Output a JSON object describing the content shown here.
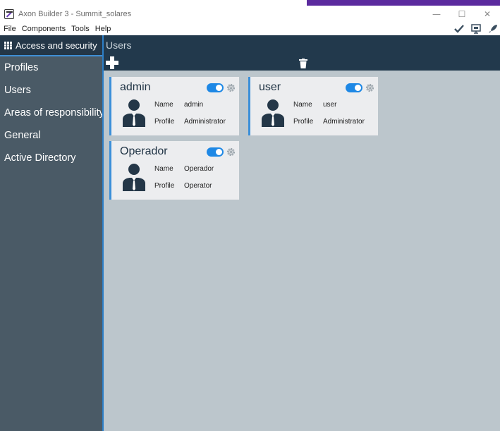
{
  "window": {
    "title": "Axon Builder 3 - Summit_solares",
    "controls": {
      "minimize": "—",
      "maximize": "☐",
      "close": "✕"
    }
  },
  "menu": {
    "items": [
      "File",
      "Components",
      "Tools",
      "Help"
    ],
    "tool_icons": [
      "check-icon",
      "monitor-icon",
      "rocket-icon"
    ]
  },
  "sidebar": {
    "title": "Access and security",
    "items": [
      "Profiles",
      "Users",
      "Areas of responsibility",
      "General",
      "Active Directory"
    ]
  },
  "main": {
    "title": "Users",
    "cards": [
      {
        "name": "admin",
        "enabled": true,
        "name_label": "Name",
        "name_value": "admin",
        "profile_label": "Profile",
        "profile_value": "Administrator"
      },
      {
        "name": "user",
        "enabled": true,
        "name_label": "Name",
        "name_value": "user",
        "profile_label": "Profile",
        "profile_value": "Administrator"
      },
      {
        "name": "Operador",
        "enabled": true,
        "name_label": "Name",
        "name_value": "Operador",
        "profile_label": "Profile",
        "profile_value": "Operator"
      }
    ]
  },
  "colors": {
    "accent": "#3b8fd9",
    "sidebar_bg": "#4a5a66",
    "header_bg": "#22394c",
    "content_bg": "#bcc6cc",
    "card_bg": "#ecedef",
    "toggle_on": "#1e88e5"
  }
}
